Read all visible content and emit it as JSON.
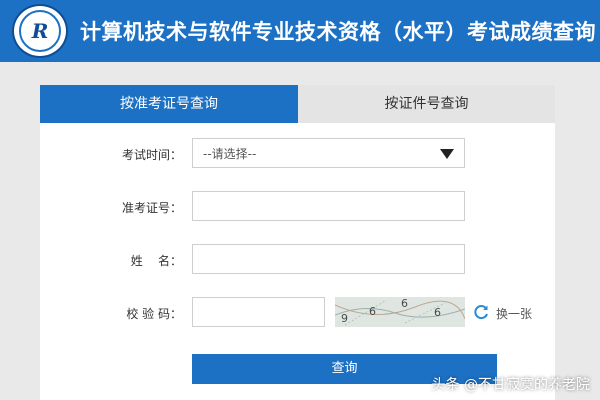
{
  "header": {
    "logo_letter": "R",
    "title": "计算机技术与软件专业技术资格（水平）考试成绩查询"
  },
  "tabs": [
    {
      "label": "按准考证号查询"
    },
    {
      "label": "按证件号查询"
    }
  ],
  "form": {
    "exam_time": {
      "label": "考试时间：",
      "value": "--请选择--"
    },
    "ticket_no": {
      "label": "准考证号：",
      "value": ""
    },
    "name": {
      "label": "姓    名：",
      "value": ""
    },
    "captcha": {
      "label": "校 验 码：",
      "value": "",
      "chars": [
        "9",
        "6",
        "6",
        "6"
      ],
      "refresh_label": "换一张"
    }
  },
  "submit_label": "查询",
  "watermark": "头条 @不甘寂寞的养老院",
  "colors": {
    "brand": "#1d71c4",
    "tab_inactive": "#e4e4e4"
  }
}
